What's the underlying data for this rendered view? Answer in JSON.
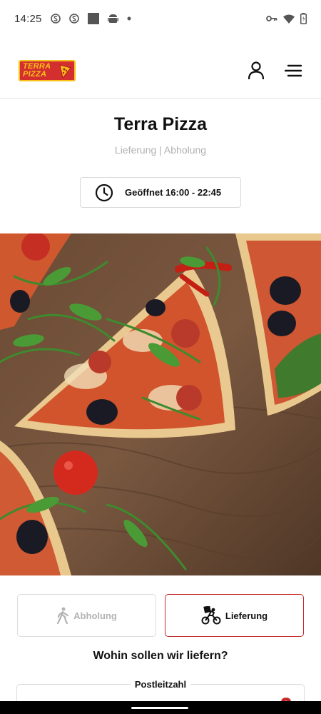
{
  "status_bar": {
    "time": "14:25",
    "icons": [
      "s-icon",
      "s-icon",
      "square-icon",
      "android-icon",
      "dot-icon",
      "vpn-key-icon",
      "wifi-icon",
      "battery-icon"
    ]
  },
  "header": {
    "logo_line1": "TERRA",
    "logo_line2": "PIZZA",
    "icons": [
      "user-icon",
      "menu-icon"
    ]
  },
  "shop": {
    "title": "Terra Pizza",
    "subtitle": "Lieferung | Abholung",
    "hours": "Geöffnet 16:00 - 22:45"
  },
  "mode": {
    "pickup_label": "Abholung",
    "delivery_label": "Lieferung",
    "selected": "delivery"
  },
  "delivery": {
    "question": "Wohin sollen wir liefern?",
    "postcode_label": "Postleitzahl"
  },
  "colors": {
    "accent": "#c62828",
    "logo_red": "#d32f2f",
    "logo_yellow": "#f6c21a",
    "muted_text": "#b0b0b0"
  }
}
